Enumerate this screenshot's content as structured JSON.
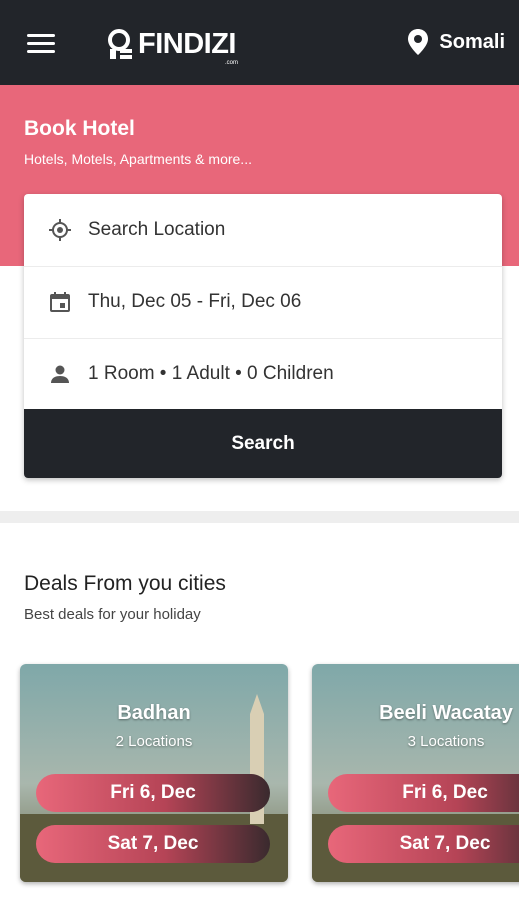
{
  "header": {
    "logo_text": "FINDIZI",
    "logo_sub": ".com",
    "location_label": "Somali"
  },
  "hero": {
    "title": "Book Hotel",
    "subtitle": "Hotels, Motels, Apartments & more..."
  },
  "search_card": {
    "location_placeholder": "Search Location",
    "dates": "Thu, Dec 05 - Fri, Dec 06",
    "guests": "1 Room • 1 Adult • 0 Children",
    "search_label": "Search"
  },
  "deals": {
    "title": "Deals From you cities",
    "subtitle": "Best deals for your holiday",
    "cities": [
      {
        "name": "Badhan",
        "count": "2 Locations",
        "date_from": "Fri 6, Dec",
        "date_to": "Sat 7, Dec"
      },
      {
        "name": "Beeli Wacatay",
        "count": "3 Locations",
        "date_from": "Fri 6, Dec",
        "date_to": "Sat 7, Dec"
      }
    ]
  },
  "colors": {
    "topbar": "#22252a",
    "accent": "#e8677a",
    "button": "#22252a"
  },
  "icons": {
    "menu": "menu-icon",
    "location": "map-pin-icon",
    "target": "my-location-icon",
    "calendar": "calendar-icon",
    "person": "person-icon"
  }
}
